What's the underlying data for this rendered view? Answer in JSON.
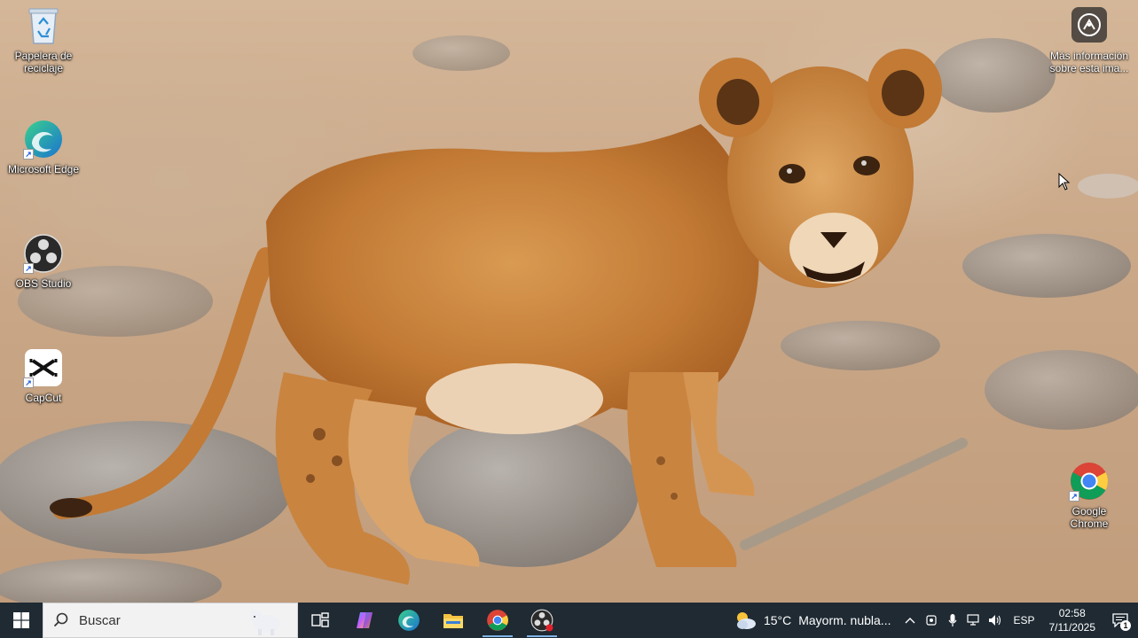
{
  "desktop": {
    "icons": [
      {
        "label": "Papelera de\nreciclaje",
        "icon": "recycle-bin-icon"
      },
      {
        "label": "Microsoft Edge",
        "icon": "edge-icon"
      },
      {
        "label": "OBS Studio",
        "icon": "obs-icon"
      },
      {
        "label": "CapCut",
        "icon": "capcut-icon"
      },
      {
        "label": "Google Chrome",
        "icon": "chrome-icon"
      }
    ],
    "info_button": {
      "label": "Más información\nsobre esta ima...",
      "icon": "camera-info-icon"
    }
  },
  "taskbar": {
    "search": {
      "placeholder": "Buscar"
    },
    "apps": [
      {
        "name": "task-view",
        "icon": "task-view-icon"
      },
      {
        "name": "copilot",
        "icon": "copilot-icon"
      },
      {
        "name": "edge",
        "icon": "edge-icon"
      },
      {
        "name": "file-explorer",
        "icon": "folder-icon"
      },
      {
        "name": "chrome",
        "icon": "chrome-icon",
        "active": true
      },
      {
        "name": "obs",
        "icon": "obs-icon",
        "active": true
      }
    ],
    "weather": {
      "temp": "15°C",
      "condition": "Mayorm. nubla...",
      "icon": "partly-cloudy-icon"
    },
    "language": "ESP",
    "clock": {
      "time": "02:58",
      "date": "7/11/2025"
    },
    "notifications": {
      "count": "1"
    }
  },
  "colors": {
    "taskbar": "#1f2a33",
    "search_bg": "#f2f2f2",
    "active_indicator": "#7fb3e6"
  }
}
